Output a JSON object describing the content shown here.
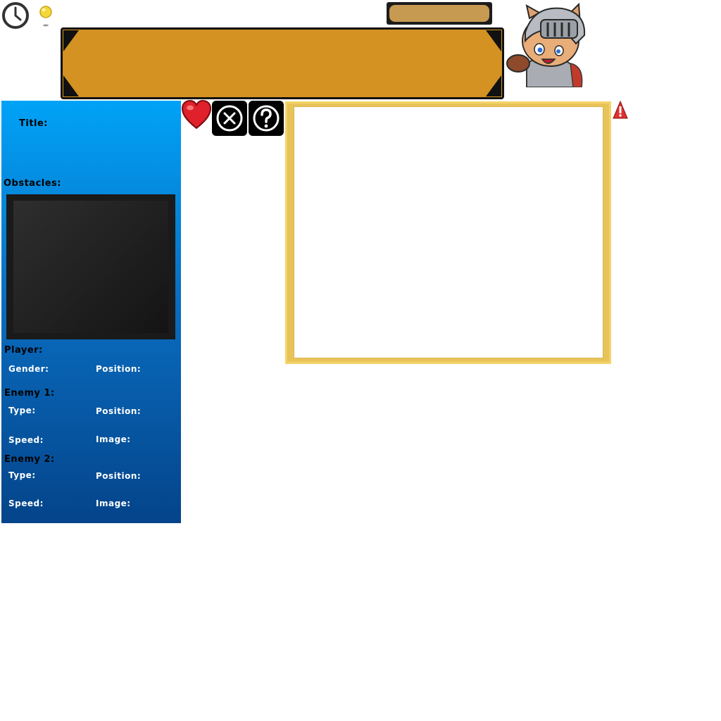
{
  "hud": {
    "clock_icon": "clock-icon",
    "hint_icon": "lightbulb-icon",
    "label_plate_text": "",
    "banner_text": ""
  },
  "panel": {
    "title_label": "Title:",
    "obstacles_label": "Obstacles:",
    "player": {
      "header": "Player:",
      "gender_label": "Gender:",
      "position_label": "Position:"
    },
    "enemy1": {
      "header": "Enemy 1:",
      "type_label": "Type:",
      "position_label": "Position:",
      "speed_label": "Speed:",
      "image_label": "Image:"
    },
    "enemy2": {
      "header": "Enemy 2:",
      "type_label": "Type:",
      "position_label": "Position:",
      "speed_label": "Speed:",
      "image_label": "Image:"
    }
  },
  "actions": {
    "favorite_icon": "heart-icon",
    "close_icon": "close-icon",
    "help_icon": "question-icon",
    "warning_icon": "warning-icon"
  },
  "colors": {
    "panel_top": "#00a3f7",
    "panel_bottom": "#04448a",
    "banner": "#d39222",
    "plate": "#c69a50",
    "frame": "#e8c35a",
    "heart": "#e0202a",
    "warning": "#e03030"
  }
}
